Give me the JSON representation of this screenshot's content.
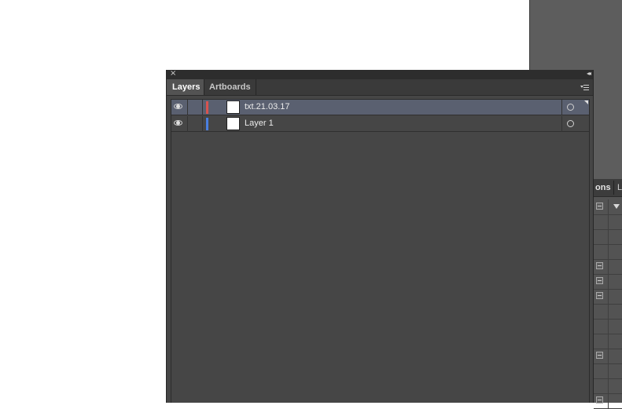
{
  "panel": {
    "close_glyph": "×",
    "collapse_glyph": "◂◂",
    "tabs": [
      {
        "label": "Layers",
        "active": true
      },
      {
        "label": "Artboards",
        "active": false
      }
    ],
    "menu_icon": "panel-menu-icon"
  },
  "layers": [
    {
      "name": "txt.21.03.17",
      "color": "#d9534f",
      "visible": true,
      "selected": true
    },
    {
      "name": "Layer 1",
      "color": "#4a7fe0",
      "visible": true,
      "selected": false
    }
  ],
  "background_panel": {
    "tabs": [
      {
        "label": "ons"
      },
      {
        "label": "L"
      }
    ]
  }
}
